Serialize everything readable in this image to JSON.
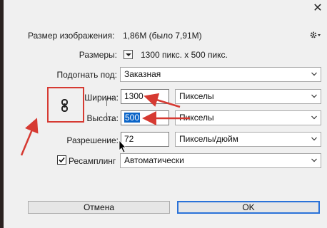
{
  "window": {
    "close_glyph": "✕"
  },
  "image_size": {
    "label": "Размер изображения:",
    "value": "1,86M (было 7,91M)"
  },
  "dimensions": {
    "label": "Размеры:",
    "value": "1300 пикс. x 500 пикс."
  },
  "fit_to": {
    "label": "Подогнать под:",
    "value": "Заказная"
  },
  "width": {
    "label": "Ширина:",
    "value": "1300",
    "unit": "Пикселы"
  },
  "height": {
    "label": "Высота:",
    "value": "500",
    "unit": "Пикселы"
  },
  "resolution": {
    "label": "Разрешение:",
    "value": "72",
    "unit": "Пикселы/дюйм"
  },
  "resample": {
    "label": "Ресамплинг",
    "checked": true,
    "value": "Автоматически"
  },
  "buttons": {
    "cancel": "Отмена",
    "ok": "OK"
  },
  "icons": {
    "gear": "gear-icon",
    "chain": "chain-link-icon",
    "checkmark": "checkmark-icon",
    "chevron": "chevron-down-icon",
    "cursor": "mouse-cursor-icon",
    "arrows": "red-annotation-arrow"
  },
  "colors": {
    "annotation": "#d63a32",
    "selection": "#0a64c8",
    "ok_border": "#2a72d8",
    "dialog_bg": "#f0f0f0"
  }
}
